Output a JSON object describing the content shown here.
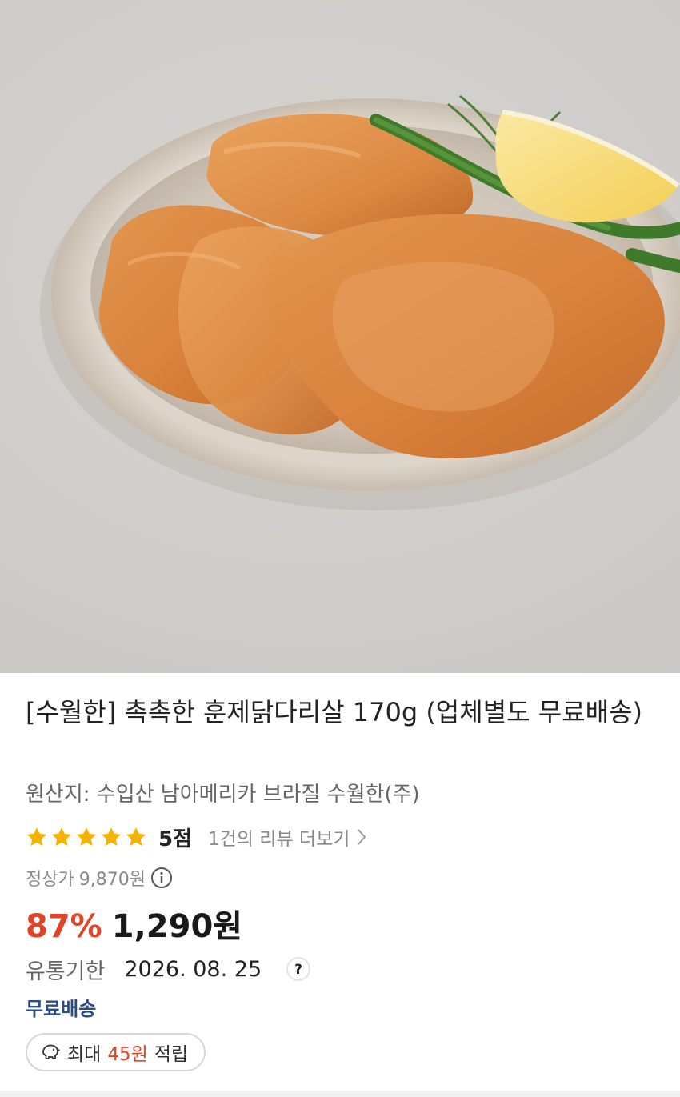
{
  "product": {
    "image_icon": "food-photo-chicken-plate",
    "title": "[수월한] 촉촉한 훈제닭다리살 170g (업체별도 무료배송)",
    "origin": "원산지: 수입산 남아메리카 브라질 수월한(주)",
    "rating": {
      "stars": 5,
      "score_label": "5점",
      "review_link": "1건의 리뷰 더보기"
    },
    "list_price": {
      "label": "정상가",
      "value": "9,870원"
    },
    "discount_rate": "87%",
    "sale_price": "1,290원",
    "expiry": {
      "label": "유통기한",
      "value": "2026. 08. 25"
    },
    "shipping": "무료배송",
    "points": {
      "prefix": "최대",
      "amount": "45원",
      "suffix": "적립"
    }
  },
  "colors": {
    "accent_red": "#e0452a",
    "star_yellow": "#f5b301",
    "shipping_blue": "#2a4b86"
  }
}
